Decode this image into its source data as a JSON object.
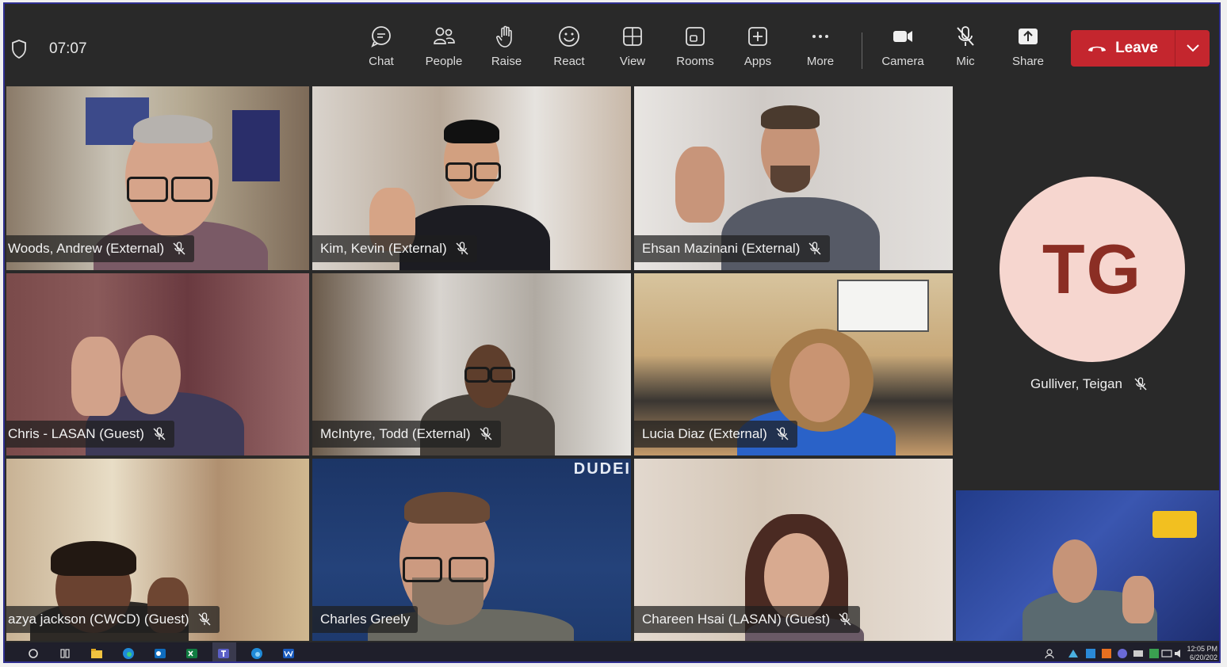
{
  "meeting": {
    "timer": "07:07"
  },
  "toolbar": {
    "buttons": [
      {
        "label": "Chat",
        "icon": "chat-icon"
      },
      {
        "label": "People",
        "icon": "people-icon"
      },
      {
        "label": "Raise",
        "icon": "raise-hand-icon"
      },
      {
        "label": "React",
        "icon": "react-icon"
      },
      {
        "label": "View",
        "icon": "view-icon"
      },
      {
        "label": "Rooms",
        "icon": "rooms-icon"
      },
      {
        "label": "Apps",
        "icon": "apps-icon"
      },
      {
        "label": "More",
        "icon": "more-icon"
      },
      {
        "label": "Camera",
        "icon": "camera-icon"
      },
      {
        "label": "Mic",
        "icon": "mic-off-icon"
      },
      {
        "label": "Share",
        "icon": "share-icon"
      }
    ],
    "leave_label": "Leave"
  },
  "participants": [
    {
      "name": "Woods, Andrew (External)"
    },
    {
      "name": "Kim, Kevin (External)"
    },
    {
      "name": "Ehsan Mazinani (External)"
    },
    {
      "name": "Chris - LASAN (Guest)"
    },
    {
      "name": "McIntyre, Todd (External)"
    },
    {
      "name": "Lucia Diaz (External)"
    },
    {
      "name": "azya jackson (CWCD) (Guest)"
    },
    {
      "name": "Charles Greely"
    },
    {
      "name": "Chareen Hsai (LASAN) (Guest)"
    }
  ],
  "featured": {
    "initials": "TG",
    "name": "Gulliver, Teigan"
  },
  "backgrounds": {
    "charles_bg_text": "DUDEI"
  },
  "taskbar": {
    "time": "12:05 PM",
    "date": "6/20/202"
  },
  "colors": {
    "leave": "#c4262e",
    "avatar_bg": "#f6d6cf",
    "avatar_text": "#8b2e24",
    "toolbar_bg": "#292929"
  }
}
